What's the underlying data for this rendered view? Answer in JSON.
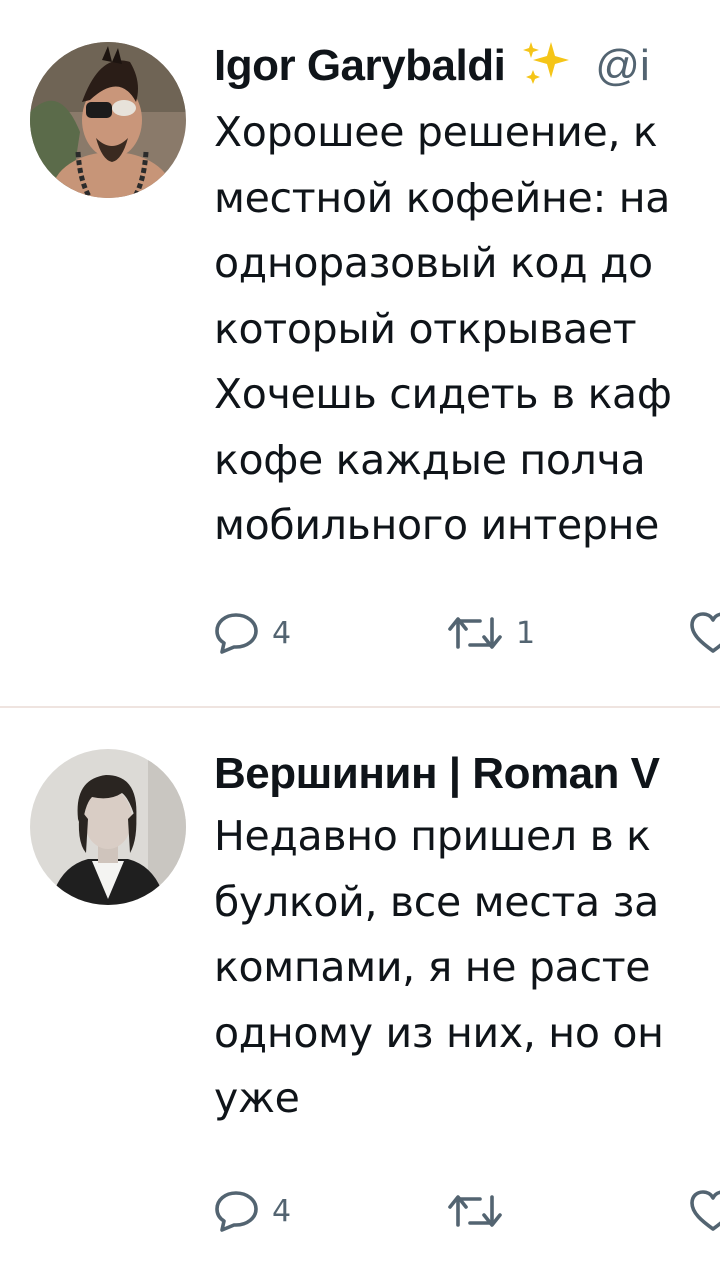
{
  "tweets": [
    {
      "author_name": "Igor Garybaldi",
      "author_badge_icon": "sparkles-icon",
      "handle": "@i",
      "lines": [
        "Хорошее решение, к",
        "местной кофейне: на",
        "одноразовый код до",
        "который открывает",
        "Хочешь сидеть в каф",
        "кофе каждые полча",
        "мобильного интерне"
      ],
      "reply_count": "4",
      "retweet_count": "1",
      "like_count": ""
    },
    {
      "author_name": "Вершинин | Roman V",
      "handle": "",
      "lines": [
        "Недавно пришел в к",
        "булкой, все места за",
        "компами, я не расте",
        "одному из них, но он",
        "уже"
      ],
      "reply_count": "4",
      "retweet_count": "",
      "like_count": ""
    }
  ],
  "colors": {
    "text": "#0f1419",
    "muted": "#536471",
    "divider": "#efe4e0",
    "sparkle": "#f5c518"
  }
}
